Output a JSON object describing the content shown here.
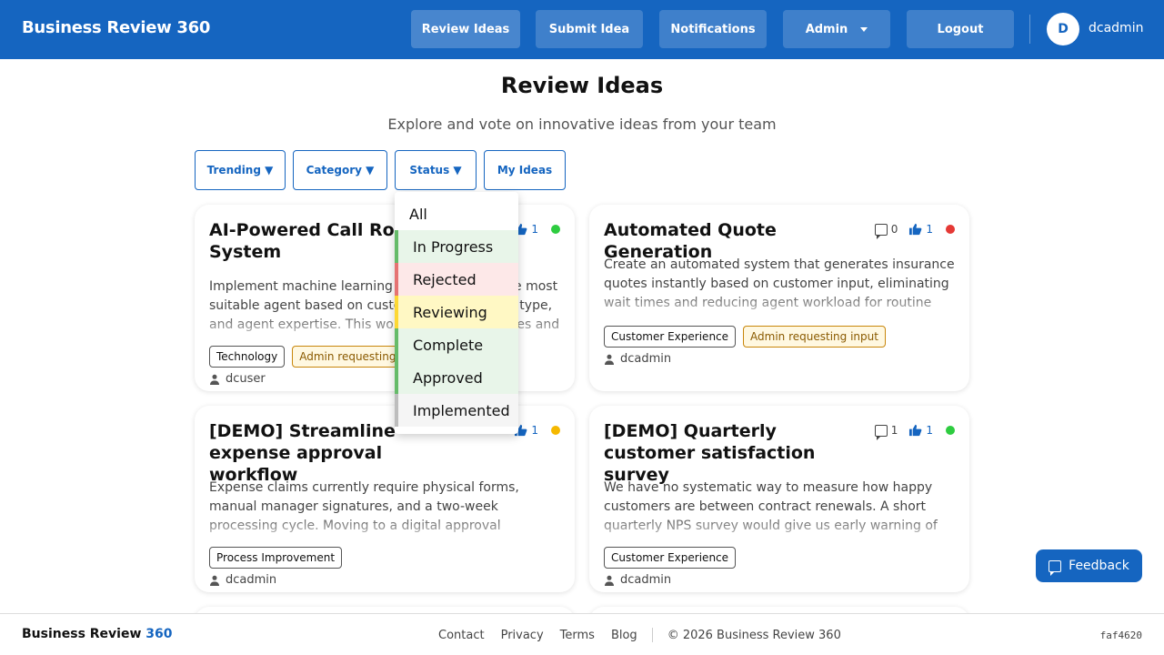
{
  "app": {
    "brand": "Business Review 360"
  },
  "nav": {
    "items": [
      "Review Ideas",
      "Submit Idea",
      "Notifications",
      "Admin",
      "Logout"
    ],
    "user_initial": "D",
    "username": "dcadmin"
  },
  "page": {
    "title": "Review Ideas",
    "subtitle": "Explore and vote on innovative ideas from your team"
  },
  "filters": {
    "trending": "Trending ▼",
    "category": "Category ▼",
    "status": "Status ▼",
    "my_ideas": "My Ideas"
  },
  "status_dropdown": {
    "options": [
      {
        "label": "All"
      },
      {
        "label": "In Progress",
        "bg": "#e8f5e9",
        "border": "#66bb6a"
      },
      {
        "label": "Rejected",
        "bg": "#fde8e8",
        "border": "#e57373"
      },
      {
        "label": "Reviewing",
        "bg": "#fff8c4",
        "border": "#fdd835"
      },
      {
        "label": "Complete",
        "bg": "#e8f5e9",
        "border": "#66bb6a"
      },
      {
        "label": "Approved",
        "bg": "#e8f5e9",
        "border": "#66bb6a"
      },
      {
        "label": "Implemented",
        "bg": "#f5f5f5",
        "border": "#bdbdbd"
      }
    ]
  },
  "ideas": [
    {
      "title": "AI-Powered Call Routing System",
      "comments": "",
      "likes": "1",
      "status_color": "#2ecc40",
      "description": "Implement machine learning to route calls to the most suitable agent based on customer history, issue type, and agent expertise. This would reduce wait times and improve first call resolution.",
      "tags": [
        "Technology",
        "Admin requesting input"
      ],
      "author": "dcuser"
    },
    {
      "title": "Automated Quote Generation",
      "comments": "0",
      "likes": "1",
      "status_color": "#e53935",
      "description": "Create an automated system that generates insurance quotes instantly based on customer input, eliminating wait times and reducing agent workload for routine quote requests.",
      "tags": [
        "Customer Experience",
        "Admin requesting input"
      ],
      "author": "dcadmin"
    },
    {
      "title": "[DEMO] Streamline expense approval workflow",
      "comments": "",
      "likes": "1",
      "status_color": "#f5b800",
      "description": "Expense claims currently require physical forms, manual manager signatures, and a two-week processing cycle. Moving to a digital approval workflow would cut processing time.",
      "tags": [
        "Process Improvement"
      ],
      "author": "dcadmin"
    },
    {
      "title": "[DEMO] Quarterly customer satisfaction survey",
      "comments": "1",
      "likes": "1",
      "status_color": "#2ecc40",
      "description": "We have no systematic way to measure how happy customers are between contract renewals. A short quarterly NPS survey would give us early warning of at-risk accounts.",
      "tags": [
        "Customer Experience"
      ],
      "author": "dcadmin"
    }
  ],
  "feedback": {
    "label": "Feedback"
  },
  "footer": {
    "brand_main": "Business Review",
    "brand_accent": "360",
    "links": [
      "Contact",
      "Privacy",
      "Terms",
      "Blog"
    ],
    "copyright": "© 2026 Business Review 360",
    "version": "faf4620"
  }
}
